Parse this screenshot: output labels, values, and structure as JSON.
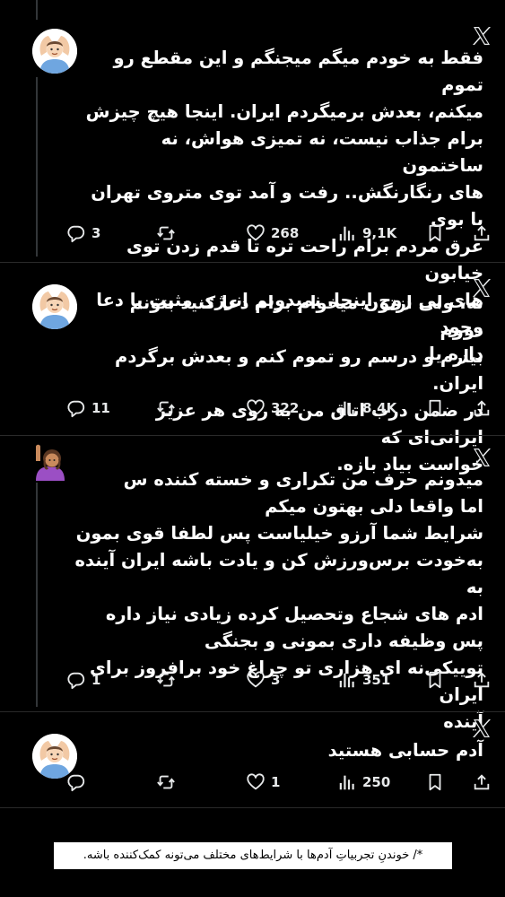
{
  "tweets": [
    {
      "text": "فقط به خودم میگم میجنگم و این مقطع رو تموم\nمیکنم، بعدش برمیگردم ایران. اینجا هیچ چیزش\nبرام جذاب نیست، نه تمیزی هواش، نه ساختمون\nهای رنگارنگش.. رفت و آمد توی متروی تهران با بوی\nعرق مردم برام راحت تره تا قدم زدن توی خیابون\nهای بی روح اینجا. نمیدونم انرژی مثبت یا دعا وجود\nداره یا",
      "replies": "3",
      "likes": "268",
      "views": "9,1K",
      "avatar": "man-gesturing-ok-emoji"
    },
    {
      "text": "نه، ولی ازتون میخوام برام دعا کنید بتونم دووم\nبیارم و درسم رو تموم کنم و بعدش برگردم ایران.\nدر ضمن درب اتاق من به روی هر عزیز ایرانی‌ای که\nخواست بیاد بازه.",
      "replies": "11",
      "likes": "322",
      "views": "8,4K",
      "avatar": "man-gesturing-ok-emoji"
    },
    {
      "text": "میدونم حرف من تکراری و خسته کننده س\nاما واقعا دلی بهتون میکم\nشرایط شما آرزو خیلیاست پس لطفا قوی بمون\nبه‌خودت برس‌ورزش کن و یادت باشه ایران آینده به\nادم های شجاع وتحصیل کرده زیادی نیاز داره\nپس وظیفه داری بمونی و بجنگی\nتوییکی‌نه ای هزاری تو چراغ خود برافروز برای ایران\nآینده",
      "replies": "1",
      "likes": "3",
      "views": "351",
      "avatar": "woman-raising-hand-emoji"
    },
    {
      "text": "آدم حسابی هستید",
      "replies": "",
      "likes": "1",
      "views": "250",
      "avatar": "man-gesturing-ok-emoji"
    }
  ],
  "caption": "*/ خوندنِ تجربیاتِ آدم‌ها با شرایط‌های مختلف می‌تونه کمک‌کننده باشه.",
  "colors": {
    "background": "#000000",
    "text": "#ffffff",
    "icon": "#e7e9ea",
    "line": "#333639"
  }
}
